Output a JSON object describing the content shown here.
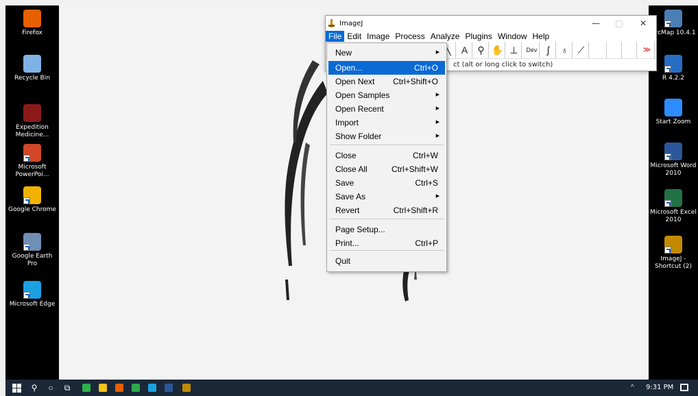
{
  "desktop_left": [
    {
      "label": "Firefox",
      "color": "#e66000",
      "shortcut": false
    },
    {
      "label": "Recycle Bin",
      "color": "#7fb2e5",
      "shortcut": false
    },
    {
      "label": "Expedition Medicine...",
      "color": "#8b1a1a",
      "shortcut": false
    },
    {
      "label": "Microsoft PowerPoi...",
      "color": "#d24726",
      "shortcut": true
    },
    {
      "label": "Google Chrome",
      "color": "#f2b300",
      "shortcut": true
    },
    {
      "label": "Google Earth Pro",
      "color": "#6f8fb5",
      "shortcut": true
    },
    {
      "label": "Microsoft Edge",
      "color": "#1ba1e2",
      "shortcut": true
    }
  ],
  "desktop_right": [
    {
      "label": "ArcMap 10.4.1",
      "color": "#4a7fb5",
      "shortcut": true
    },
    {
      "label": "R 4.2.2",
      "color": "#276dc3",
      "shortcut": true
    },
    {
      "label": "Start Zoom",
      "color": "#2d8cff",
      "shortcut": false
    },
    {
      "label": "Microsoft Word 2010",
      "color": "#2b579a",
      "shortcut": true
    },
    {
      "label": "Microsoft Excel 2010",
      "color": "#217346",
      "shortcut": true
    },
    {
      "label": "ImageJ - Shortcut (2)",
      "color": "#c28a00",
      "shortcut": true
    }
  ],
  "imagej": {
    "title": "ImageJ",
    "min_label": "—",
    "max_label": "□",
    "close_label": "✕",
    "menus": [
      "File",
      "Edit",
      "Image",
      "Process",
      "Analyze",
      "Plugins",
      "Window",
      "Help"
    ],
    "active_menu": "File",
    "status_text": "ct (alt or long click to switch)"
  },
  "file_menu": {
    "items": [
      {
        "label": "New",
        "shortcut": "",
        "submenu": true
      },
      {
        "label": "Open...",
        "shortcut": "Ctrl+O",
        "submenu": false,
        "highlighted": true
      },
      {
        "label": "Open Next",
        "shortcut": "Ctrl+Shift+O",
        "submenu": false
      },
      {
        "label": "Open Samples",
        "shortcut": "",
        "submenu": true
      },
      {
        "label": "Open Recent",
        "shortcut": "",
        "submenu": true
      },
      {
        "label": "Import",
        "shortcut": "",
        "submenu": true
      },
      {
        "label": "Show Folder",
        "shortcut": "",
        "submenu": true
      },
      {
        "label": "Close",
        "shortcut": "Ctrl+W",
        "submenu": false
      },
      {
        "label": "Close All",
        "shortcut": "Ctrl+Shift+W",
        "submenu": false
      },
      {
        "label": "Save",
        "shortcut": "Ctrl+S",
        "submenu": false
      },
      {
        "label": "Save As",
        "shortcut": "",
        "submenu": true
      },
      {
        "label": "Revert",
        "shortcut": "Ctrl+Shift+R",
        "submenu": false
      },
      {
        "label": "Page Setup...",
        "shortcut": "",
        "submenu": false
      },
      {
        "label": "Print...",
        "shortcut": "Ctrl+P",
        "submenu": false
      },
      {
        "label": "Quit",
        "shortcut": "",
        "submenu": false
      }
    ],
    "submenu_glyph": "▶"
  },
  "toolbar": {
    "tools": [
      {
        "glyph": "╲",
        "name": "line-tool-icon"
      },
      {
        "glyph": "A",
        "name": "text-tool-icon"
      },
      {
        "glyph": "⚲",
        "name": "magnifier-icon"
      },
      {
        "glyph": "✋",
        "name": "hand-tool-icon"
      },
      {
        "glyph": "⊥",
        "name": "dropper-icon"
      },
      {
        "glyph": "Dev",
        "name": "developer-menu-icon"
      },
      {
        "glyph": "∫",
        "name": "brush-icon"
      },
      {
        "glyph": "♁",
        "name": "stamp-icon"
      },
      {
        "glyph": "⟋",
        "name": "pencil-icon"
      },
      {
        "glyph": "",
        "name": "empty-slot-icon"
      },
      {
        "glyph": "",
        "name": "empty-slot-icon"
      },
      {
        "glyph": "",
        "name": "empty-slot-icon"
      },
      {
        "glyph": "≫",
        "name": "more-tools-icon"
      }
    ]
  },
  "taskbar": {
    "time": "9:31 PM",
    "chevron": "^",
    "apps": [
      {
        "name": "search-icon",
        "glyph": "⚲",
        "color": "#ffffff"
      },
      {
        "name": "cortana-icon",
        "glyph": "○",
        "color": "#ffffff"
      },
      {
        "name": "task-view-icon",
        "glyph": "⧉",
        "color": "#ffffff"
      },
      {
        "name": "edge-icon",
        "glyph": "",
        "color": "#2fb24c"
      },
      {
        "name": "file-explorer-icon",
        "glyph": "",
        "color": "#f0c419"
      },
      {
        "name": "firefox-icon",
        "glyph": "",
        "color": "#e66000"
      },
      {
        "name": "camtasia-icon",
        "glyph": "",
        "color": "#2fa84f"
      },
      {
        "name": "chrome-icon",
        "glyph": "",
        "color": "#1ba1e2"
      },
      {
        "name": "word-icon",
        "glyph": "",
        "color": "#2b579a"
      },
      {
        "name": "imagej-icon",
        "glyph": "",
        "color": "#c28a00"
      }
    ]
  }
}
